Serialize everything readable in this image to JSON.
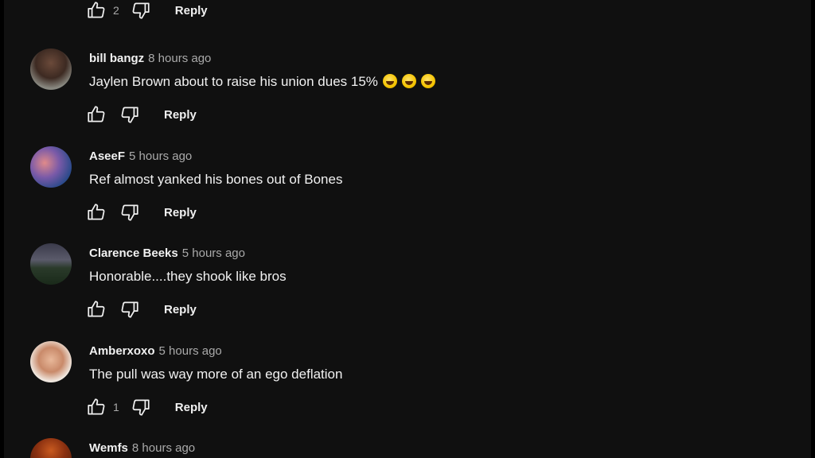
{
  "comments": [
    {
      "author": "",
      "time": "",
      "text": "",
      "likes": "2",
      "reply": "Reply"
    },
    {
      "author": "bill bangz",
      "time": "8 hours ago",
      "text": "Jaylen Brown about to raise his union dues 15%",
      "likes": "",
      "reply": "Reply",
      "emojis": [
        "rolling-on-floor-laughing",
        "rolling-on-floor-laughing",
        "rolling-on-floor-laughing"
      ]
    },
    {
      "author": "AseeF",
      "time": "5 hours ago",
      "text": "Ref almost yanked his bones out of Bones",
      "likes": "",
      "reply": "Reply"
    },
    {
      "author": "Clarence Beeks",
      "time": "5 hours ago",
      "text": "Honorable....they shook like bros",
      "likes": "",
      "reply": "Reply"
    },
    {
      "author": "Amberxoxo",
      "time": "5 hours ago",
      "text": "The pull was way more of an ego deflation",
      "likes": "1",
      "reply": "Reply"
    },
    {
      "author": "Wemfs",
      "time": "8 hours ago",
      "text": "",
      "likes": "",
      "reply": ""
    }
  ],
  "colors": {
    "background": "#0f0f0f",
    "text": "#f1f1f1",
    "secondary_text": "#aaaaaa"
  }
}
